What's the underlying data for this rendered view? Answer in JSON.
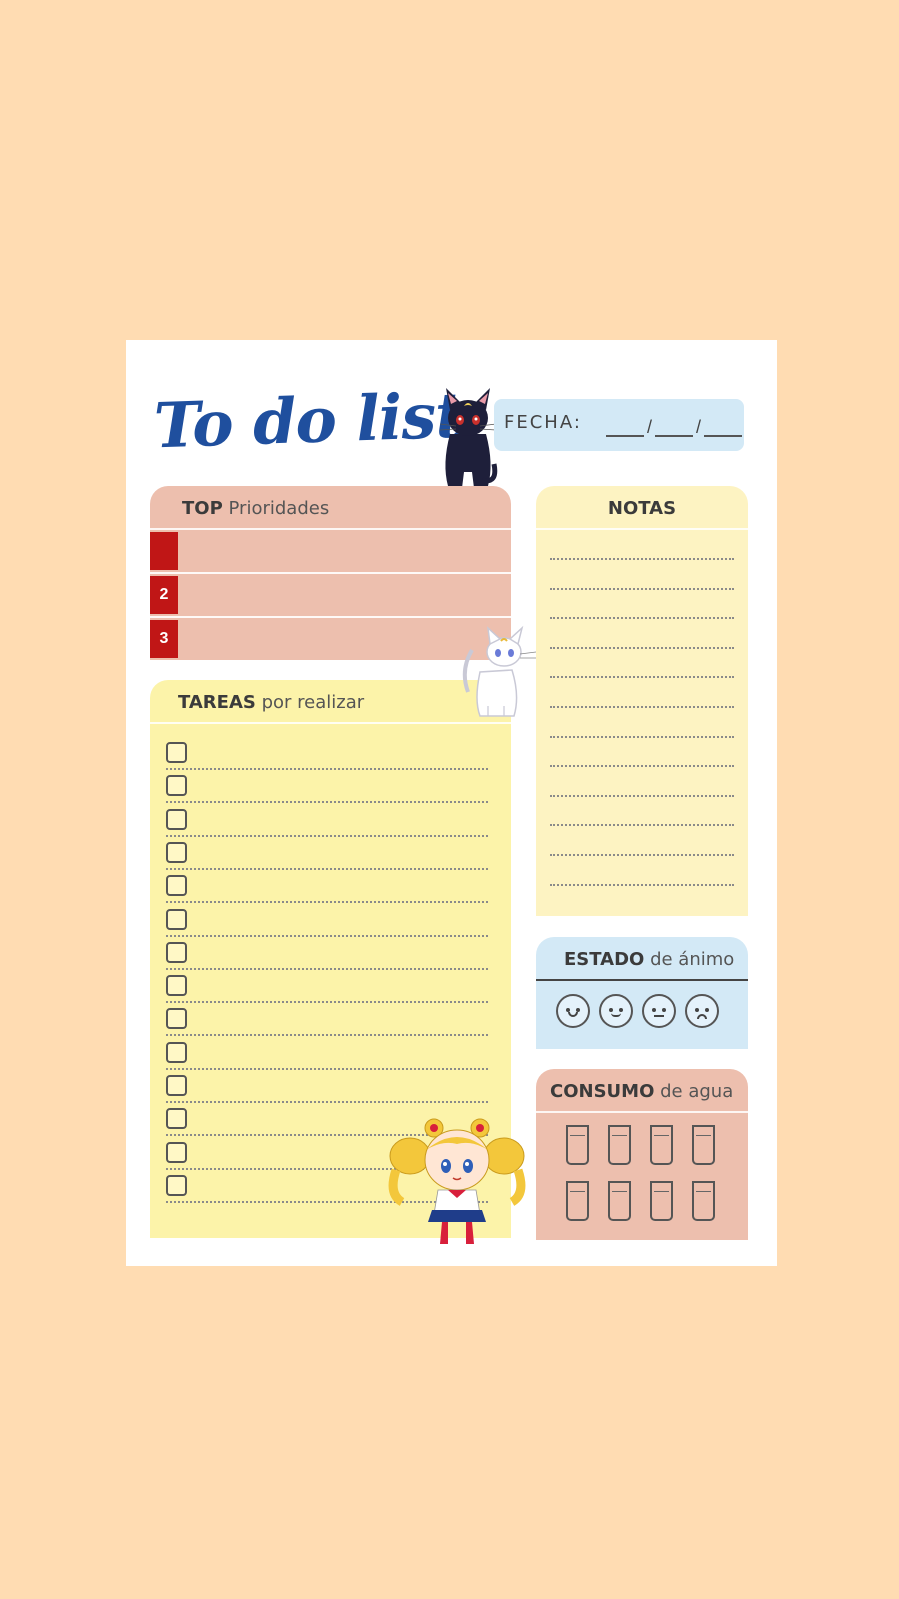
{
  "header": {
    "title": "To do list",
    "date_label": "FECHA:",
    "date_separator": "/"
  },
  "top": {
    "title_bold": "TOP",
    "title_thin": "Prioridades",
    "items": [
      "",
      "2",
      "3"
    ]
  },
  "tareas": {
    "title_bold": "TAREAS",
    "title_thin": "por realizar",
    "task_count": 14
  },
  "notas": {
    "title": "NOTAS",
    "line_count": 12
  },
  "estado": {
    "title_bold": "ESTADO",
    "title_thin": "de ánimo",
    "faces": [
      "happy-face-icon",
      "smile-face-icon",
      "neutral-face-icon",
      "sad-face-icon"
    ]
  },
  "consumo": {
    "title_bold": "CONSUMO",
    "title_thin": "de agua",
    "glass_count": 8
  },
  "colors": {
    "background": "#ffdcb2",
    "title_blue": "#1f4f9e",
    "pink_panel": "#edbfae",
    "yellow_panel": "#fcf3a9",
    "notes_panel": "#fdf3c2",
    "blue_panel": "#d3e9f6",
    "priority_red": "#c01616"
  }
}
